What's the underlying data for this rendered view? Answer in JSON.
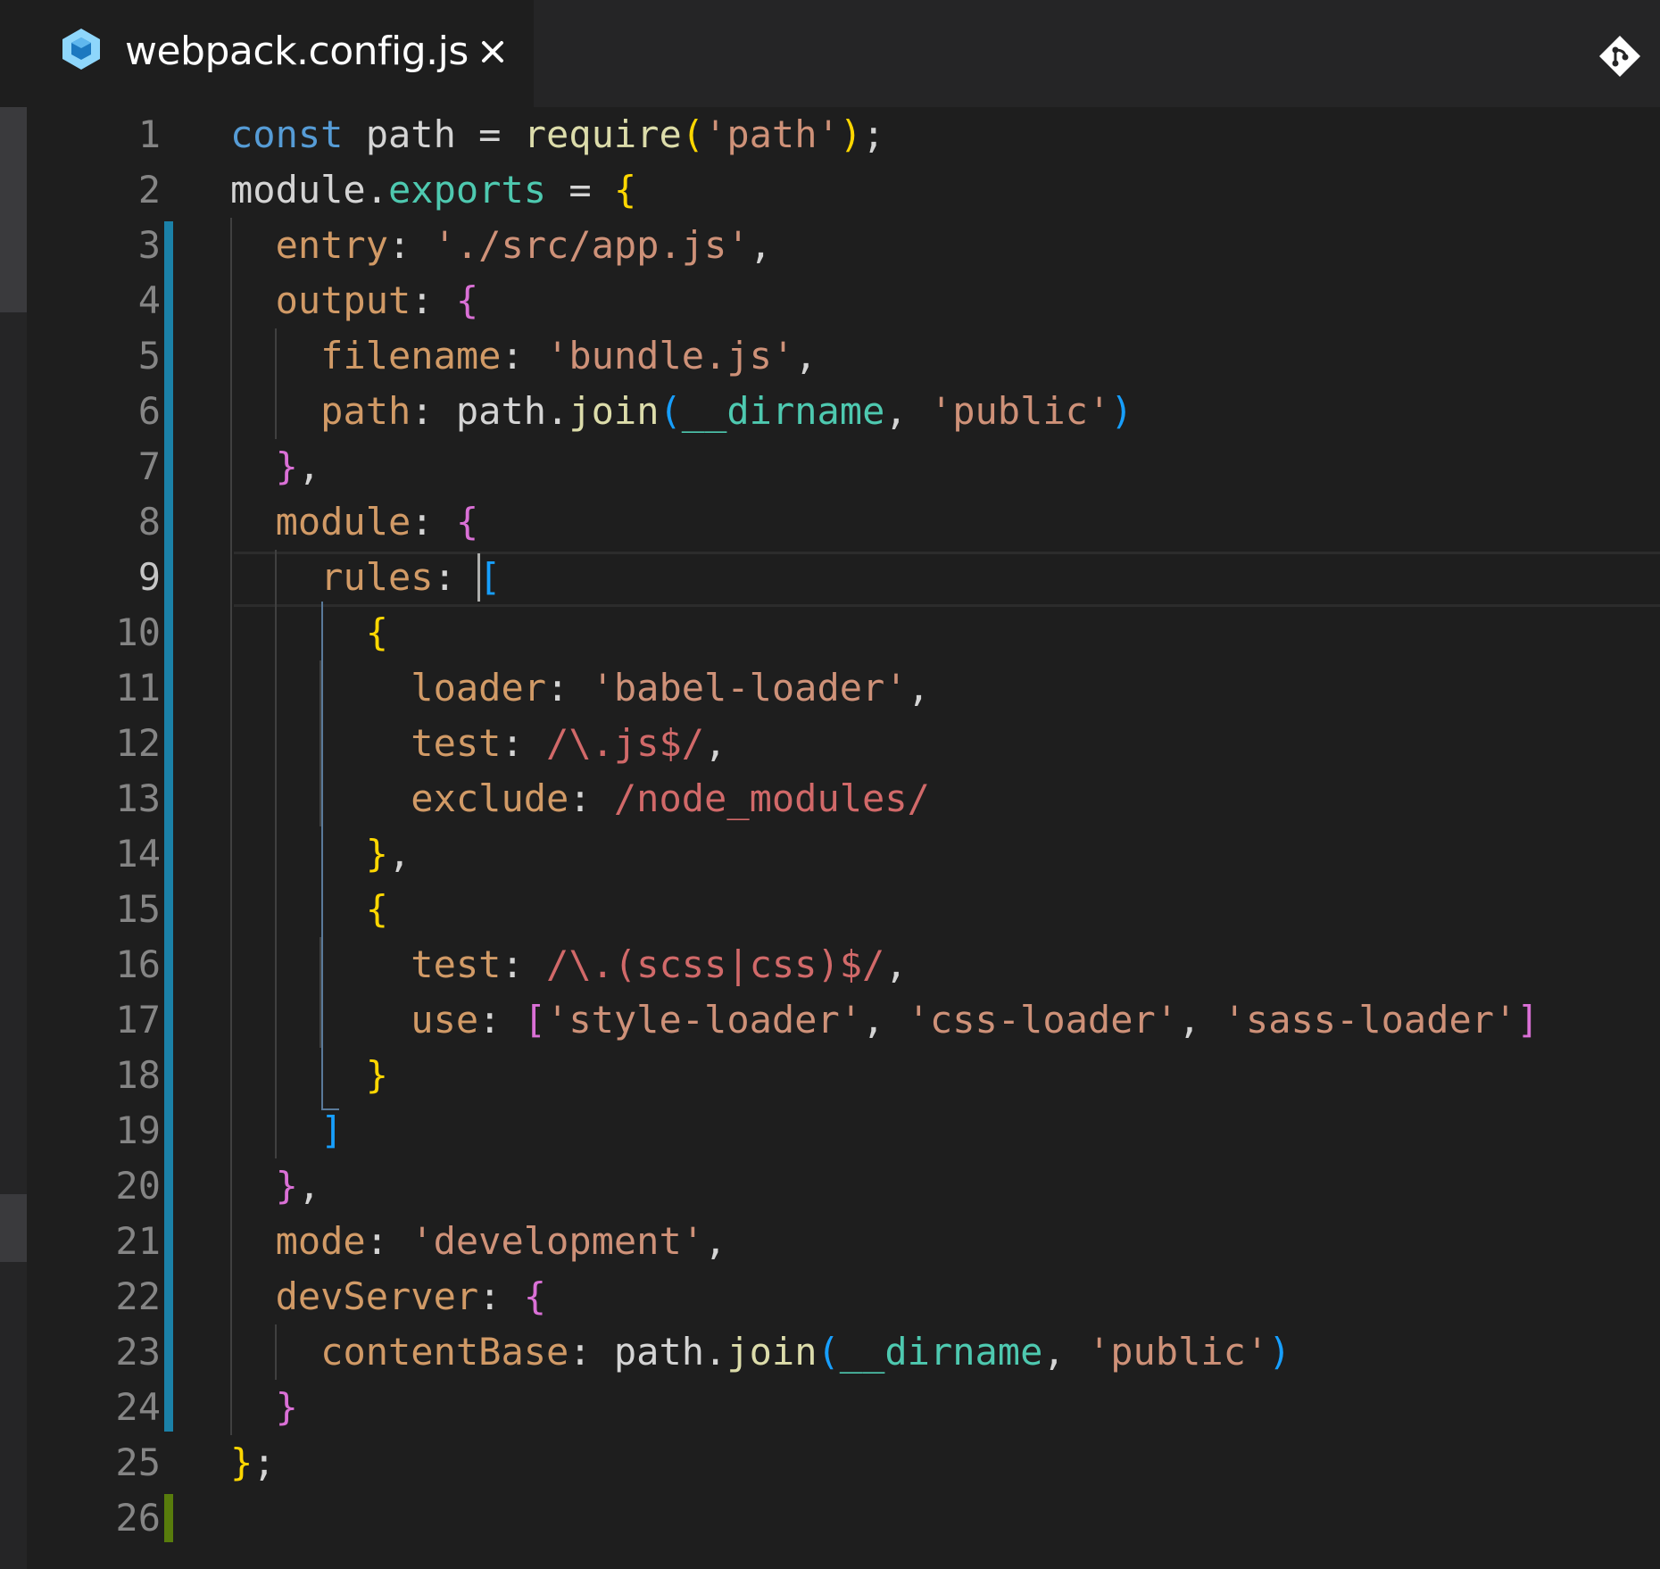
{
  "tab": {
    "title": "webpack.config.js",
    "close_glyph": "×",
    "file_icon": "webpack-cube-icon",
    "action_icon": "git-compare-icon"
  },
  "editor": {
    "active_line": 9,
    "line_numbers": [
      "1",
      "2",
      "3",
      "4",
      "5",
      "6",
      "7",
      "8",
      "9",
      "10",
      "11",
      "12",
      "13",
      "14",
      "15",
      "16",
      "17",
      "18",
      "19",
      "20",
      "21",
      "22",
      "23",
      "24",
      "25",
      "26"
    ],
    "lines": [
      [
        [
          "k",
          "const"
        ],
        [
          "v",
          " path = "
        ],
        [
          "fn",
          "require"
        ],
        [
          "y",
          "("
        ],
        [
          "s",
          "'path'"
        ],
        [
          "y",
          ")"
        ],
        [
          "c",
          ";"
        ]
      ],
      [
        [
          "v",
          "module"
        ],
        [
          "c",
          "."
        ],
        [
          "m",
          "exports"
        ],
        [
          "c",
          " = "
        ],
        [
          "y",
          "{"
        ]
      ],
      [
        [
          "c",
          "  "
        ],
        [
          "p",
          "entry"
        ],
        [
          "c",
          ": "
        ],
        [
          "s",
          "'./src/app.js'"
        ],
        [
          "c",
          ","
        ]
      ],
      [
        [
          "c",
          "  "
        ],
        [
          "p",
          "output"
        ],
        [
          "c",
          ": "
        ],
        [
          "pk",
          "{"
        ]
      ],
      [
        [
          "c",
          "    "
        ],
        [
          "p",
          "filename"
        ],
        [
          "c",
          ": "
        ],
        [
          "s",
          "'bundle.js'"
        ],
        [
          "c",
          ","
        ]
      ],
      [
        [
          "c",
          "    "
        ],
        [
          "p",
          "path"
        ],
        [
          "c",
          ": "
        ],
        [
          "v",
          "path"
        ],
        [
          "c",
          "."
        ],
        [
          "fn",
          "join"
        ],
        [
          "bl",
          "("
        ],
        [
          "m",
          "__dirname"
        ],
        [
          "c",
          ", "
        ],
        [
          "s",
          "'public'"
        ],
        [
          "bl",
          ")"
        ]
      ],
      [
        [
          "c",
          "  "
        ],
        [
          "pk",
          "}"
        ],
        [
          "c",
          ","
        ]
      ],
      [
        [
          "c",
          "  "
        ],
        [
          "p",
          "module"
        ],
        [
          "c",
          ": "
        ],
        [
          "pk",
          "{"
        ]
      ],
      [
        [
          "c",
          "    "
        ],
        [
          "p",
          "rules"
        ],
        [
          "c",
          ": "
        ],
        [
          "bl",
          "["
        ]
      ],
      [
        [
          "c",
          "      "
        ],
        [
          "y",
          "{"
        ]
      ],
      [
        [
          "c",
          "        "
        ],
        [
          "p",
          "loader"
        ],
        [
          "c",
          ": "
        ],
        [
          "s",
          "'babel-loader'"
        ],
        [
          "c",
          ","
        ]
      ],
      [
        [
          "c",
          "        "
        ],
        [
          "p",
          "test"
        ],
        [
          "c",
          ": "
        ],
        [
          "re",
          "/\\.js$/"
        ],
        [
          "c",
          ","
        ]
      ],
      [
        [
          "c",
          "        "
        ],
        [
          "p",
          "exclude"
        ],
        [
          "c",
          ": "
        ],
        [
          "re",
          "/node_modules/"
        ]
      ],
      [
        [
          "c",
          "      "
        ],
        [
          "y",
          "}"
        ],
        [
          "c",
          ","
        ]
      ],
      [
        [
          "c",
          "      "
        ],
        [
          "y",
          "{"
        ]
      ],
      [
        [
          "c",
          "        "
        ],
        [
          "p",
          "test"
        ],
        [
          "c",
          ": "
        ],
        [
          "re",
          "/\\.(scss|css)$/"
        ],
        [
          "c",
          ","
        ]
      ],
      [
        [
          "c",
          "        "
        ],
        [
          "p",
          "use"
        ],
        [
          "c",
          ": "
        ],
        [
          "pk",
          "["
        ],
        [
          "s",
          "'style-loader'"
        ],
        [
          "c",
          ", "
        ],
        [
          "s",
          "'css-loader'"
        ],
        [
          "c",
          ", "
        ],
        [
          "s",
          "'sass-loader'"
        ],
        [
          "pk",
          "]"
        ]
      ],
      [
        [
          "c",
          "      "
        ],
        [
          "y",
          "}"
        ]
      ],
      [
        [
          "c",
          "    "
        ],
        [
          "bl",
          "]"
        ]
      ],
      [
        [
          "c",
          "  "
        ],
        [
          "pk",
          "}"
        ],
        [
          "c",
          ","
        ]
      ],
      [
        [
          "c",
          "  "
        ],
        [
          "p",
          "mode"
        ],
        [
          "c",
          ": "
        ],
        [
          "s",
          "'development'"
        ],
        [
          "c",
          ","
        ]
      ],
      [
        [
          "c",
          "  "
        ],
        [
          "p",
          "devServer"
        ],
        [
          "c",
          ": "
        ],
        [
          "pk",
          "{"
        ]
      ],
      [
        [
          "c",
          "    "
        ],
        [
          "p",
          "contentBase"
        ],
        [
          "c",
          ": "
        ],
        [
          "v",
          "path"
        ],
        [
          "c",
          "."
        ],
        [
          "fn",
          "join"
        ],
        [
          "bl",
          "("
        ],
        [
          "m",
          "__dirname"
        ],
        [
          "c",
          ", "
        ],
        [
          "s",
          "'public'"
        ],
        [
          "bl",
          ")"
        ]
      ],
      [
        [
          "c",
          "  "
        ],
        [
          "pk",
          "}"
        ]
      ],
      [
        [
          "y",
          "}"
        ],
        [
          "c",
          ";"
        ]
      ],
      [
        [
          "c",
          ""
        ]
      ]
    ]
  },
  "colors": {
    "modified_bar": "#1b81a8",
    "added_bar": "#587c0c",
    "background": "#1e1e1e",
    "tab_bar": "#252526"
  }
}
